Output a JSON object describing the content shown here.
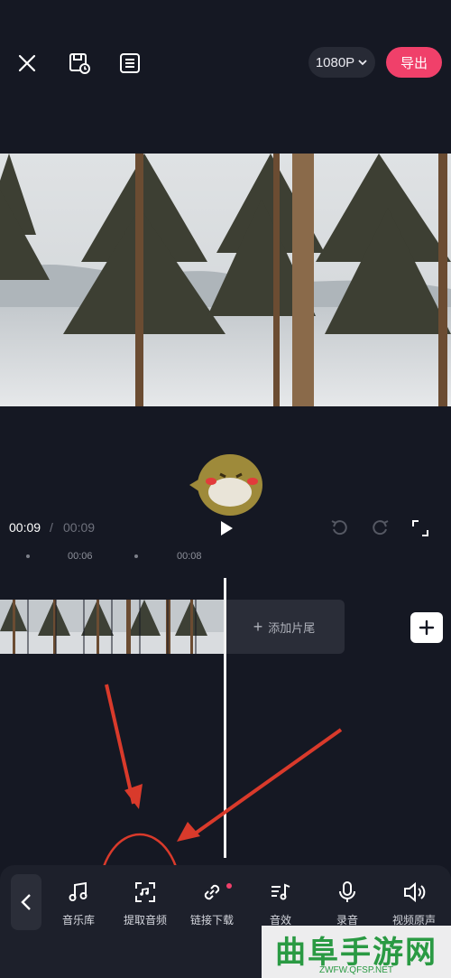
{
  "header": {
    "resolution_label": "1080P",
    "export_label": "导出"
  },
  "player": {
    "current_time": "00:09",
    "separator": "/",
    "total_time": "00:09"
  },
  "timeline": {
    "ruler_ticks": [
      "00:06",
      "00:08"
    ],
    "add_ending_label": "添加片尾"
  },
  "toolbar": {
    "items": [
      {
        "label": "音乐库",
        "icon": "music-note-icon"
      },
      {
        "label": "提取音频",
        "icon": "extract-audio-icon"
      },
      {
        "label": "链接下载",
        "icon": "link-icon"
      },
      {
        "label": "音效",
        "icon": "sound-effect-icon"
      },
      {
        "label": "录音",
        "icon": "microphone-icon"
      },
      {
        "label": "视频原声",
        "icon": "speaker-icon"
      }
    ]
  },
  "watermark": {
    "main": "曲阜手游网",
    "sub": "ZWFW.QFSP.NET"
  },
  "colors": {
    "accent": "#f0406a",
    "background": "#151823",
    "annotation_red": "#d93a2b"
  }
}
